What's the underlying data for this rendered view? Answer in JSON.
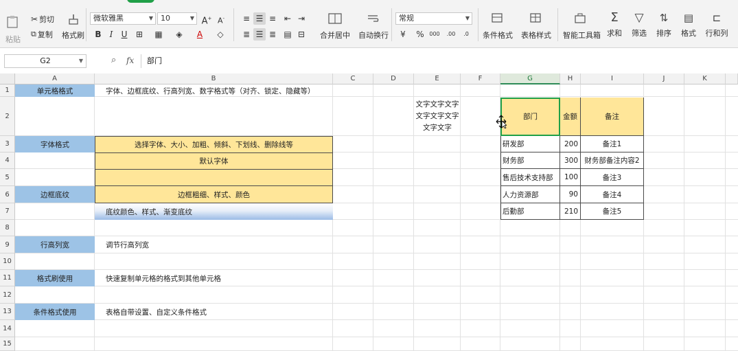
{
  "ribbon": {
    "clipboard": {
      "paste_label": "粘贴",
      "cut_label": "剪切",
      "copy_label": "复制",
      "format_painter_label": "格式刷"
    },
    "font": {
      "family": "微软雅黑",
      "size": "10",
      "grow_icon": "A⁺",
      "shrink_icon": "A⁻",
      "clear_icon": "clear-format-icon",
      "bold": "B",
      "italic": "I",
      "underline": "U"
    },
    "alignment": {
      "merge_label": "合并居中",
      "wrap_label": "自动换行"
    },
    "number": {
      "format": "常规",
      "percent": "%",
      "thousands": "000",
      "inc_decimal": "+0\n.00",
      "dec_decimal": "-.00\n.0"
    },
    "styles": {
      "conditional_label": "条件格式",
      "table_style_label": "表格样式"
    },
    "tools": {
      "smart_toolbox_label": "智能工具箱",
      "sum_label": "求和",
      "filter_label": "筛选",
      "sort_label": "排序",
      "format_label": "格式",
      "rowcol_label": "行和列"
    }
  },
  "formula_bar": {
    "name_box": "G2",
    "fx": "fx",
    "value": "部门"
  },
  "columns": [
    "A",
    "B",
    "C",
    "D",
    "E",
    "F",
    "G",
    "H",
    "I",
    "J",
    "K"
  ],
  "rows": [
    "1",
    "2",
    "3",
    "4",
    "5",
    "6",
    "7",
    "8",
    "9",
    "10",
    "11",
    "12",
    "13",
    "14",
    "15"
  ],
  "cells": {
    "a1": "单元格格式",
    "b1": "字体、边框底纹、行高列宽、数字格式等（对齐、锁定、隐藏等）",
    "e2_line1": "文字文字文字",
    "e2_line2": "文字文字文字",
    "e2_line3": "文字文字",
    "a3": "字体格式",
    "b3": "选择字体、大小、加粗、倾斜、下划线、删除线等",
    "b4": "默认字体",
    "a6": "边框底纹",
    "b6": "边框粗细、样式、颜色",
    "b7": "底纹颜色、样式、渐变底纹",
    "a9": "行高列宽",
    "b9": "调节行高列宽",
    "a11": "格式刷使用",
    "b11": "快速复制单元格的格式到其他单元格",
    "a13": "条件格式使用",
    "b13": "表格自带设置、自定义条件格式"
  },
  "table": {
    "headers": [
      "部门",
      "金额",
      "备注"
    ],
    "rows": [
      [
        "研发部",
        "200",
        "备注1"
      ],
      [
        "财务部",
        "300",
        "财务部备注内容2"
      ],
      [
        "售后技术支持部",
        "100",
        "备注3"
      ],
      [
        "人力资源部",
        "90",
        "备注4"
      ],
      [
        "后勤部",
        "210",
        "备注5"
      ]
    ]
  },
  "colors": {
    "accent_green": "#1f9f47",
    "header_blue": "#9dc3e6",
    "highlight_gold": "#ffe699"
  }
}
